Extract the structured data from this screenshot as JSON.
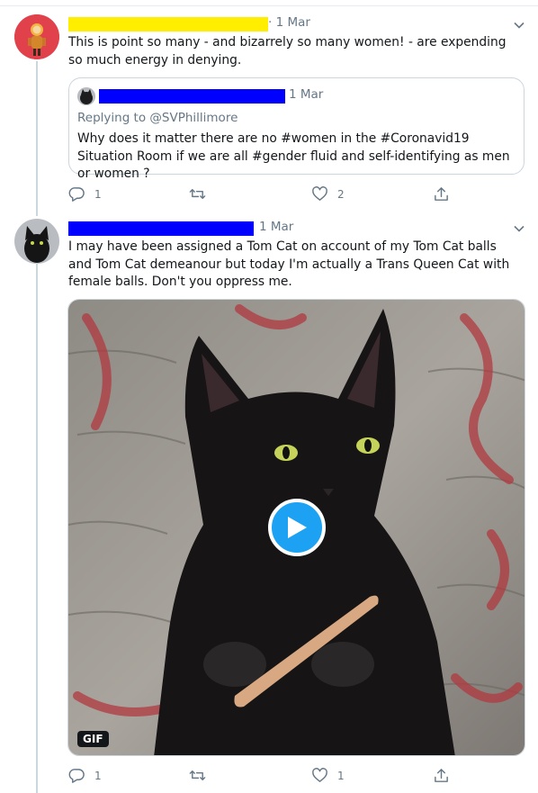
{
  "tweets": [
    {
      "date": "· 1 Mar",
      "text": "This is point so many - and bizarrely so many women! - are expending so much energy in denying.",
      "quote": {
        "date": "1 Mar",
        "replying_to": "Replying to @SVPhillimore",
        "text": "Why does it matter there are no #women in the #Coronavid19 Situation Room if we are all #gender fluid and self-identifying as men or women  ?"
      },
      "actions": {
        "reply_count": "1",
        "retweet_count": "",
        "like_count": "2"
      },
      "name_redaction_color": "#ffee00"
    },
    {
      "date": "1 Mar",
      "text": "I may have been assigned a Tom Cat on account of my Tom Cat balls and Tom Cat demeanour but today I'm actually a Trans Queen Cat with female balls. Don't you oppress me.",
      "media": {
        "badge": "GIF",
        "play_icon": "play-icon"
      },
      "actions": {
        "reply_count": "1",
        "retweet_count": "",
        "like_count": "1"
      },
      "name_redaction_color": "#0000ff"
    }
  ],
  "colors": {
    "accent": "#1da1f2",
    "muted": "#657786",
    "border": "#ccd6dd"
  }
}
